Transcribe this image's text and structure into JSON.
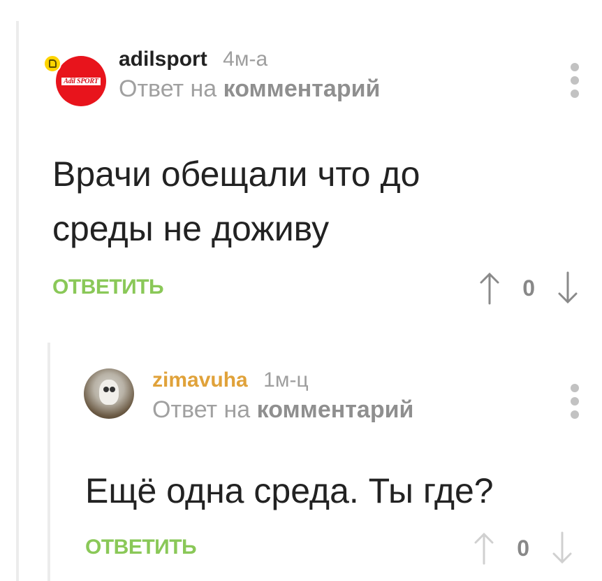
{
  "comments": [
    {
      "username": "adilsport",
      "time": "4м-а",
      "reply_prefix": "Ответ на",
      "reply_target": "комментарий",
      "avatar_logo_text": "Adil SPORT",
      "text_lines": [
        "Врачи обещали что до",
        "среды не доживу"
      ],
      "reply_label": "ОТВЕТИТЬ",
      "vote_count": "0",
      "icons": {
        "upvote": "arrow-up-icon",
        "downvote": "arrow-down-icon",
        "menu": "more-vertical-icon",
        "badge": "comment-badge-icon"
      }
    },
    {
      "username": "zimavuha",
      "time": "1м-ц",
      "reply_prefix": "Ответ на",
      "reply_target": "комментарий",
      "text_lines": [
        "Ещё одна среда. Ты где?"
      ],
      "reply_label": "ОТВЕТИТЬ",
      "vote_count": "0",
      "icons": {
        "upvote": "arrow-up-icon",
        "downvote": "arrow-down-icon",
        "menu": "more-vertical-icon"
      }
    }
  ],
  "colors": {
    "reply_green": "#8ac858",
    "username_orange": "#e0a23a",
    "avatar_red": "#e8141c",
    "badge_yellow": "#ffd400"
  }
}
